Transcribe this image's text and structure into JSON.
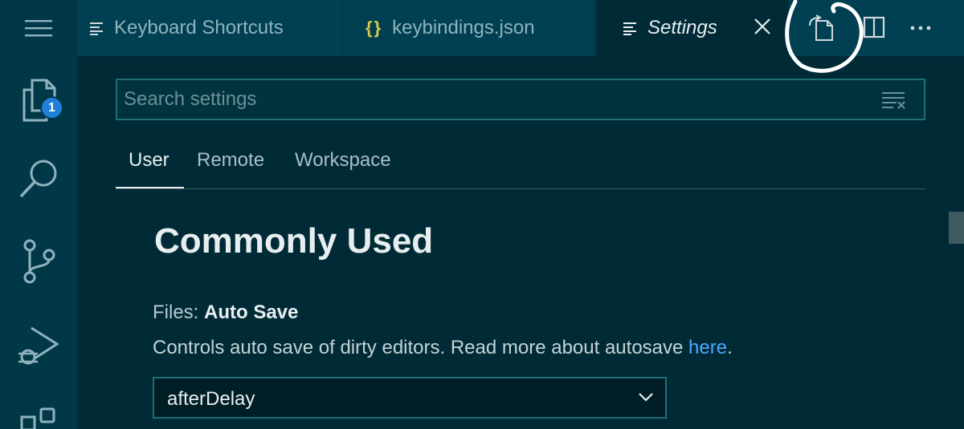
{
  "tabs": [
    {
      "label": "Keyboard Shortcuts",
      "icon": "lines-icon"
    },
    {
      "label": "keybindings.json",
      "icon": "braces-icon",
      "icon_text": "{}"
    },
    {
      "label": "Settings",
      "icon": "lines-icon",
      "active": true
    }
  ],
  "activity_bar": {
    "explorer_badge": "1"
  },
  "search": {
    "placeholder": "Search settings"
  },
  "scope_tabs": [
    "User",
    "Remote",
    "Workspace"
  ],
  "section": {
    "title": "Commonly Used"
  },
  "setting": {
    "category": "Files: ",
    "name": "Auto Save",
    "description": "Controls auto save of dirty editors. Read more about autosave ",
    "link": "here",
    "description_end": ".",
    "value": "afterDelay"
  },
  "colors": {
    "background": "#002b36",
    "activity_bar": "#003847",
    "tab_bar": "#004052",
    "badge": "#1f7fd8",
    "link": "#4aa8ff",
    "annotation": "#ffffff"
  }
}
